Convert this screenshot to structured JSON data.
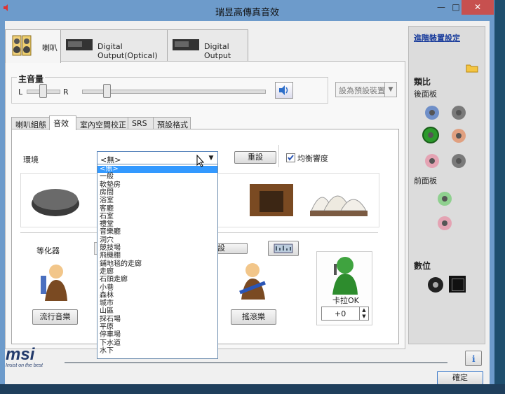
{
  "window": {
    "title": "瑞昱高傳真音效",
    "controls": {
      "minimize": "—",
      "maximize": "□",
      "close": "✕"
    }
  },
  "device_tabs": [
    {
      "label": "喇叭"
    },
    {
      "label": "Digital Output(Optical)"
    },
    {
      "label": "Digital Output"
    }
  ],
  "main_volume": {
    "label": "主音量",
    "left_label": "L",
    "right_label": "R",
    "default_device": "設為預設裝置"
  },
  "sub_tabs": [
    {
      "label": "喇叭組態"
    },
    {
      "label": "音效"
    },
    {
      "label": "室內空間校正"
    },
    {
      "label": "SRS"
    },
    {
      "label": "預設格式"
    }
  ],
  "environment": {
    "label": "環境",
    "selected": "<無>",
    "reset_label": "重設",
    "loudness_label": "均衡響度",
    "loudness_checked": true,
    "options": [
      "<無>",
      "一般",
      "軟墊房",
      "房間",
      "浴室",
      "客廳",
      "石室",
      "禮堂",
      "音樂廳",
      "洞穴",
      "競技場",
      "飛機棚",
      "鋪地毯的走廊",
      "走廊",
      "石頭走廊",
      "小巷",
      "森林",
      "城市",
      "山區",
      "採石場",
      "平原",
      "停車場",
      "下水道",
      "水下"
    ]
  },
  "equalizer": {
    "label": "等化器",
    "reset_label": "設",
    "pop_label": "流行音樂",
    "rock_label": "搖滾樂",
    "karaoke_label": "卡拉OK",
    "karaoke_value": "+0"
  },
  "right_panel": {
    "advanced_link": "進階裝置設定",
    "analog_label": "類比",
    "rear_panel": "後面板",
    "front_panel": "前面板",
    "digital_label": "數位",
    "jack_colors": {
      "blue": "#6f8fc8",
      "gray": "#7a7a7a",
      "green": "#2c9a2c",
      "orange": "#e0a080",
      "pink": "#e4a3b3",
      "front_green": "#8fd08f"
    }
  },
  "footer": {
    "brand": "msi",
    "tagline": "Insist on the best",
    "info_icon": "i",
    "ok_label": "確定"
  }
}
